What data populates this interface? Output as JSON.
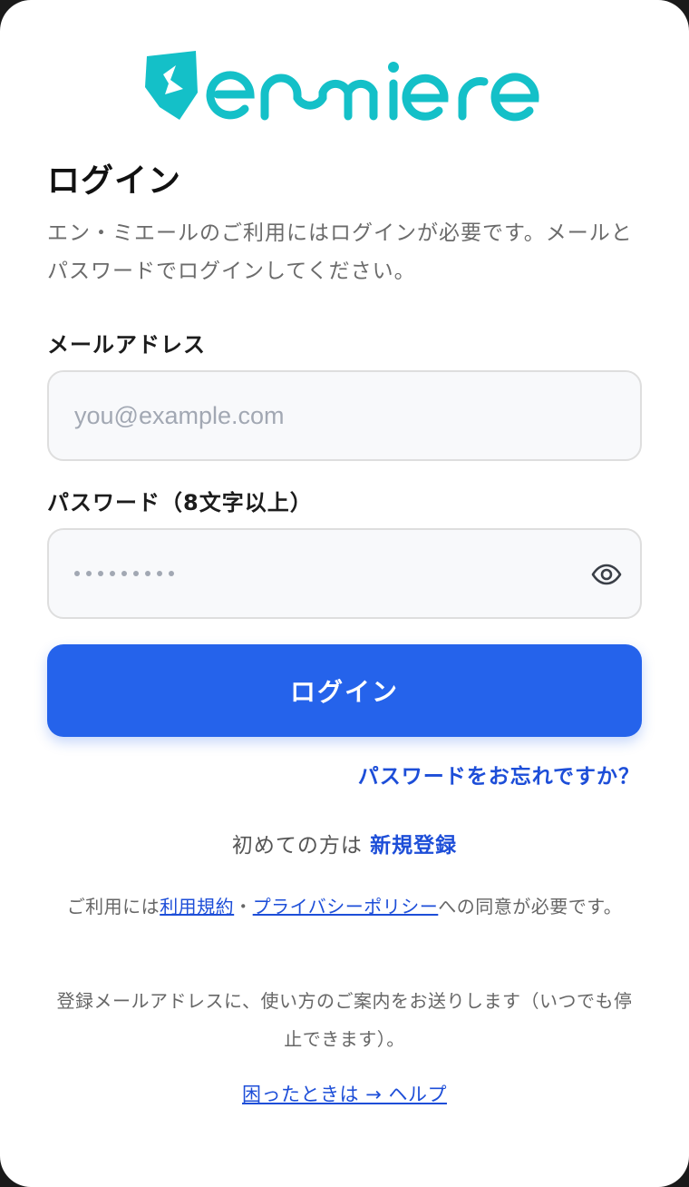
{
  "brand": {
    "name": "enmiere",
    "color": "#14c0c8"
  },
  "login": {
    "title": "ログイン",
    "subtitle": "エン・ミエールのご利用にはログインが必要です。メールとパスワードでログインしてください。"
  },
  "email": {
    "label": "メールアドレス",
    "placeholder": "you@example.com",
    "value": ""
  },
  "password": {
    "label": "パスワード（8文字以上）",
    "masked_length": 9,
    "toggle_icon": "eye-icon"
  },
  "buttons": {
    "login_label": "ログイン",
    "login_color": "#2563eb"
  },
  "links": {
    "forgot": "パスワードをお忘れですか？",
    "signup_prefix": "初めての方は",
    "signup": "新規登録",
    "terms_prefix": "ご利用には",
    "terms": "利用規約",
    "separator": "・",
    "privacy": "プライバシーポリシー",
    "terms_suffix": "への同意が必要です。",
    "help": "困ったときは → ヘルプ"
  },
  "notice": {
    "email_usage": "登録メールアドレスに、使い方のご案内をお送りします（いつでも停止できます）。"
  }
}
